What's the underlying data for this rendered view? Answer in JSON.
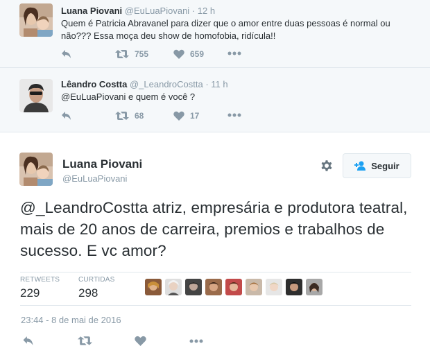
{
  "reply_context": {
    "tweet1": {
      "name": "Luana Piovani",
      "handle": "@EuLuaPiovani",
      "dot": "·",
      "time": "12 h",
      "text": "Quem é Patricia Abravanel para dizer que o amor entre duas pessoas é normal ou não??? Essa moça deu show de homofobia, ridícula!!",
      "retweets": "755",
      "likes": "659"
    },
    "tweet2": {
      "name": "Lêandro Costta",
      "handle": "@_LeandroCostta",
      "dot": "·",
      "time": "11 h",
      "text": "@EuLuaPiovani e quem é você ?",
      "retweets": "68",
      "likes": "17"
    }
  },
  "main_tweet": {
    "name": "Luana Piovani",
    "handle": "@EuLuaPiovani",
    "follow_label": "Seguir",
    "text": "@_LeandroCostta atriz, empresária e produtora teatral, mais de 20 anos de carreira, premios e trabalhos de sucesso. E vc amor?",
    "retweets_label": "RETWEETS",
    "retweets": "229",
    "likes_label": "CURTIDAS",
    "likes": "298",
    "timestamp": "23:44 - 8 de mai de 2016"
  },
  "colors": {
    "accent": "#1da1f2",
    "muted": "#8899a6",
    "text": "#292f33",
    "background_context": "#f5f8fa"
  },
  "icons": [
    "reply-icon",
    "retweet-icon",
    "heart-icon",
    "more-icon",
    "gear-icon",
    "follow-person-icon"
  ]
}
